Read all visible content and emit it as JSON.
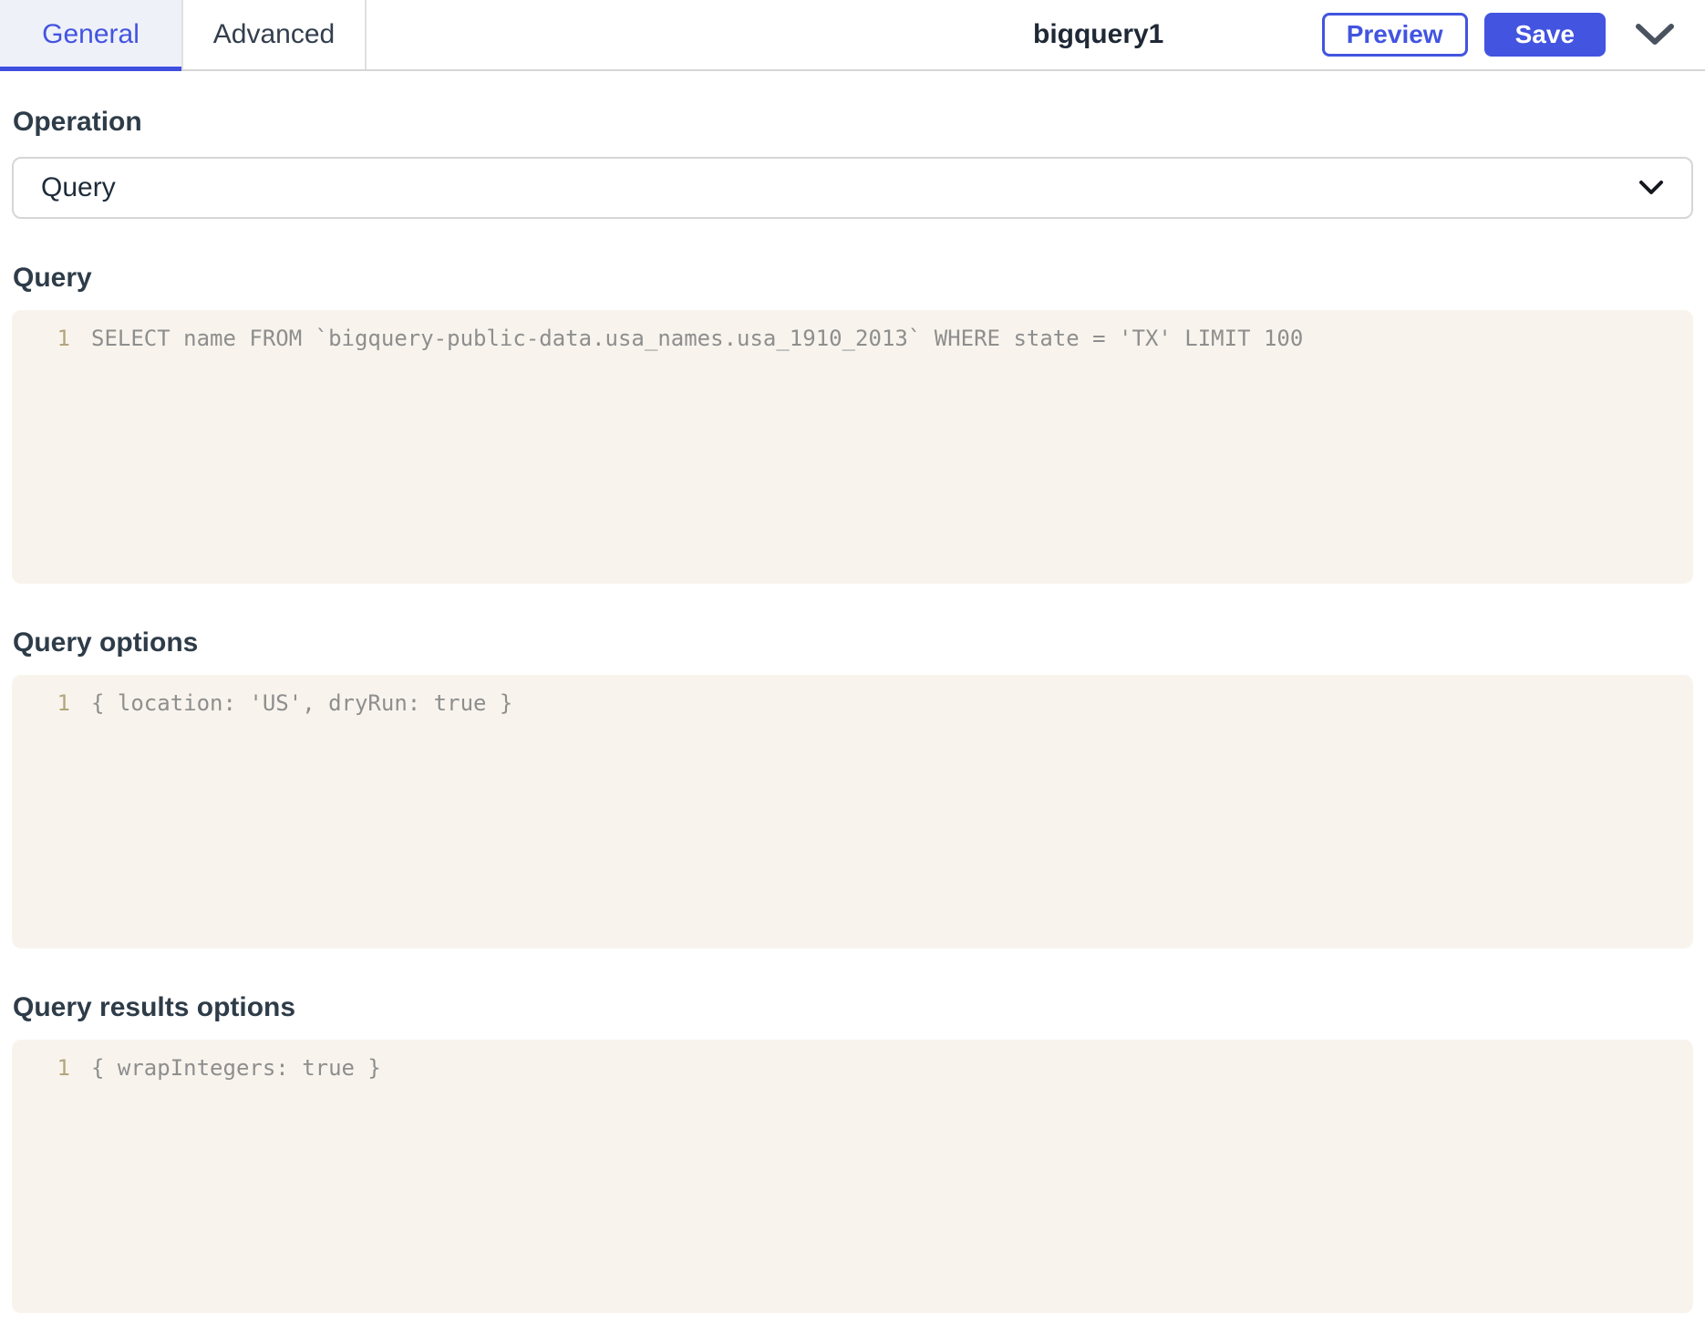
{
  "header": {
    "tabs": [
      {
        "label": "General",
        "active": true
      },
      {
        "label": "Advanced",
        "active": false
      }
    ],
    "title": "bigquery1",
    "preview_label": "Preview",
    "save_label": "Save"
  },
  "form": {
    "operation": {
      "label": "Operation",
      "value": "Query"
    },
    "query": {
      "label": "Query",
      "line_number": "1",
      "code": "SELECT name FROM `bigquery-public-data.usa_names.usa_1910_2013` WHERE state = 'TX' LIMIT 100"
    },
    "query_options": {
      "label": "Query options",
      "line_number": "1",
      "code": "{ location: 'US', dryRun: true }"
    },
    "query_results_options": {
      "label": "Query results options",
      "line_number": "1",
      "code": "{ wrapIntegers: true }"
    }
  },
  "colors": {
    "accent_blue": "#4254e0",
    "tab_active_bg": "#eff1f9",
    "tab_underline": "#3f4fe0",
    "editor_bg": "#f8f4ed",
    "code_text": "#8e8e8e",
    "line_number": "#b3a57d",
    "label_text": "#2e3c49",
    "border_gray": "#d6d6d6"
  }
}
